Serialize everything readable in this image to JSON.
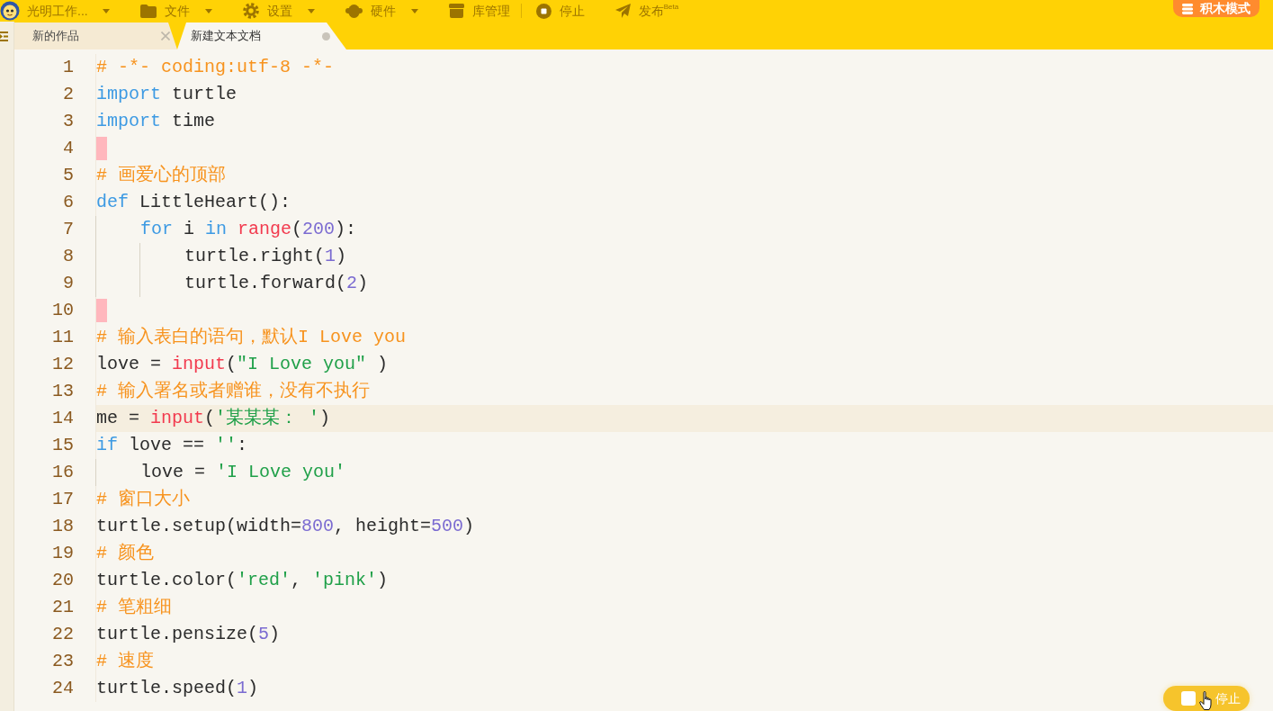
{
  "toolbar": {
    "items": [
      {
        "kind": "dropdown",
        "label": "光明工作..."
      },
      {
        "kind": "dropdown",
        "label": "文件"
      },
      {
        "kind": "dropdown",
        "label": "设置"
      },
      {
        "kind": "dropdown",
        "label": "硬件"
      },
      {
        "kind": "button",
        "label": "库管理"
      },
      {
        "kind": "separator"
      },
      {
        "kind": "button",
        "label": "停止"
      },
      {
        "kind": "button",
        "label": "发布$^{Beta}$"
      }
    ],
    "mode_button": {
      "label": "积木模式"
    }
  },
  "tabs": [
    {
      "label": "新的作品",
      "selected": false,
      "modified": false
    },
    {
      "label": "新建文本文档",
      "selected": true,
      "modified": true
    }
  ],
  "editor": {
    "lines": [
      {
        "number": "1",
        "current": false,
        "marker": false,
        "tokens": [
          {
            "kind": "comment",
            "text": "# -*- coding:utf-8 -*-"
          }
        ]
      },
      {
        "number": "2",
        "current": false,
        "marker": false,
        "tokens": [
          {
            "kind": "keyword",
            "text": "import"
          },
          {
            "kind": "plain",
            "text": " turtle"
          }
        ]
      },
      {
        "number": "3",
        "current": false,
        "marker": false,
        "tokens": [
          {
            "kind": "keyword",
            "text": "import"
          },
          {
            "kind": "plain",
            "text": " time"
          }
        ]
      },
      {
        "number": "4",
        "current": false,
        "marker": true
      },
      {
        "number": "5",
        "current": false,
        "marker": false,
        "tokens": [
          {
            "kind": "comment",
            "text": "# 画爱心的顶部"
          }
        ]
      },
      {
        "number": "6",
        "current": false,
        "marker": false,
        "tokens": [
          {
            "kind": "keyword",
            "text": "def"
          },
          {
            "kind": "plain",
            "text": " LittleHeart():"
          }
        ]
      },
      {
        "number": "7",
        "current": false,
        "marker": false,
        "tokens": [
          {
            "kind": "keyword",
            "text": "    for"
          },
          {
            "kind": "plain",
            "text": " i "
          },
          {
            "kind": "keyword",
            "text": "in"
          },
          {
            "kind": "builtin",
            "text": " range"
          },
          {
            "kind": "plain",
            "text": "("
          },
          {
            "kind": "number",
            "text": "200"
          },
          {
            "kind": "plain",
            "text": "):"
          }
        ]
      },
      {
        "number": "8",
        "current": false,
        "marker": false,
        "tokens": [
          {
            "kind": "plain",
            "text": "        turtle.right("
          },
          {
            "kind": "number",
            "text": "1"
          },
          {
            "kind": "plain",
            "text": ")"
          }
        ]
      },
      {
        "number": "9",
        "current": false,
        "marker": false,
        "tokens": [
          {
            "kind": "plain",
            "text": "        turtle.forward("
          },
          {
            "kind": "number",
            "text": "2"
          },
          {
            "kind": "plain",
            "text": ")"
          }
        ]
      },
      {
        "number": "10",
        "current": false,
        "marker": true
      },
      {
        "number": "11",
        "current": false,
        "marker": false,
        "tokens": [
          {
            "kind": "comment",
            "text": "# 输入表白的语句，默认I Love you"
          }
        ]
      },
      {
        "number": "12",
        "current": false,
        "marker": false,
        "tokens": [
          {
            "kind": "plain",
            "text": "love = "
          },
          {
            "kind": "builtin",
            "text": "input"
          },
          {
            "kind": "plain",
            "text": "("
          },
          {
            "kind": "string",
            "text": "\"I Love you\""
          },
          {
            "kind": "plain",
            "text": " )"
          }
        ]
      },
      {
        "number": "13",
        "current": false,
        "marker": false,
        "tokens": [
          {
            "kind": "comment",
            "text": "# 输入署名或者赠谁，没有不执行"
          }
        ]
      },
      {
        "number": "14",
        "current": true,
        "marker": false,
        "tokens": [
          {
            "kind": "plain",
            "text": "me = "
          },
          {
            "kind": "builtin",
            "text": "input"
          },
          {
            "kind": "plain",
            "text": "("
          },
          {
            "kind": "string",
            "text": "'某某某： '"
          },
          {
            "kind": "plain",
            "text": ")"
          }
        ]
      },
      {
        "number": "15",
        "current": false,
        "marker": false,
        "tokens": [
          {
            "kind": "keyword",
            "text": "if"
          },
          {
            "kind": "plain",
            "text": " love == "
          },
          {
            "kind": "string",
            "text": "''"
          },
          {
            "kind": "plain",
            "text": ":"
          }
        ]
      },
      {
        "number": "16",
        "current": false,
        "marker": false,
        "tokens": [
          {
            "kind": "plain",
            "text": "    love = "
          },
          {
            "kind": "string",
            "text": "'I Love you'"
          }
        ]
      },
      {
        "number": "17",
        "current": false,
        "marker": false,
        "tokens": [
          {
            "kind": "comment",
            "text": "# 窗口大小"
          }
        ]
      },
      {
        "number": "18",
        "current": false,
        "marker": false,
        "tokens": [
          {
            "kind": "plain",
            "text": "turtle.setup(width="
          },
          {
            "kind": "number",
            "text": "800"
          },
          {
            "kind": "plain",
            "text": ", height="
          },
          {
            "kind": "number",
            "text": "500"
          },
          {
            "kind": "plain",
            "text": ")"
          }
        ]
      },
      {
        "number": "19",
        "current": false,
        "marker": false,
        "tokens": [
          {
            "kind": "comment",
            "text": "# 颜色"
          }
        ]
      },
      {
        "number": "20",
        "current": false,
        "marker": false,
        "tokens": [
          {
            "kind": "plain",
            "text": "turtle.color("
          },
          {
            "kind": "string",
            "text": "'red'"
          },
          {
            "kind": "plain",
            "text": ", "
          },
          {
            "kind": "string",
            "text": "'pink'"
          },
          {
            "kind": "plain",
            "text": ")"
          }
        ]
      },
      {
        "number": "21",
        "current": false,
        "marker": false,
        "tokens": [
          {
            "kind": "comment",
            "text": "# 笔粗细"
          }
        ]
      },
      {
        "number": "22",
        "current": false,
        "marker": false,
        "tokens": [
          {
            "kind": "plain",
            "text": "turtle.pensize("
          },
          {
            "kind": "number",
            "text": "5"
          },
          {
            "kind": "plain",
            "text": ")"
          }
        ]
      },
      {
        "number": "23",
        "current": false,
        "marker": false,
        "tokens": [
          {
            "kind": "comment",
            "text": "# 速度"
          }
        ]
      },
      {
        "number": "24",
        "current": false,
        "marker": false,
        "tokens": [
          {
            "kind": "plain",
            "text": "turtle.speed("
          },
          {
            "kind": "number",
            "text": "1"
          },
          {
            "kind": "plain",
            "text": ")"
          }
        ]
      }
    ]
  },
  "stop_button": {
    "label": "停止"
  }
}
